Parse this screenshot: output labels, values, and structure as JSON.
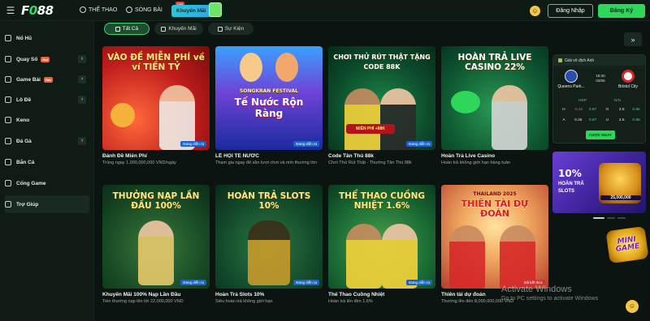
{
  "header": {
    "logo": "F088",
    "nav": [
      {
        "label": "THỂ THAO"
      },
      {
        "label": "SÒNG BÀI",
        "tag": "Live"
      }
    ],
    "promo_label": "Khuyến Mãi",
    "login_label": "Đăng Nhập",
    "register_label": "Đăng Ký"
  },
  "sidebar": {
    "items": [
      {
        "label": "Nổ Hũ",
        "icon": "slot-icon"
      },
      {
        "label": "Quay Số",
        "tag": "Hot",
        "icon": "dice-icon"
      },
      {
        "label": "Game Bài",
        "tag": "Hot",
        "icon": "cards-icon"
      },
      {
        "label": "Lô Đề",
        "icon": "lottery-icon"
      },
      {
        "label": "Keno",
        "icon": "keno-icon"
      },
      {
        "label": "Đá Gà",
        "icon": "rooster-icon"
      },
      {
        "label": "Bắn Cá",
        "icon": "fish-icon"
      },
      {
        "label": "Cổng Game",
        "icon": "gamepad-icon"
      },
      {
        "label": "Trợ Giúp",
        "icon": "help-icon"
      }
    ]
  },
  "tabs": [
    {
      "label": "Tất Cả",
      "active": true
    },
    {
      "label": "Khuyến Mãi",
      "active": false
    },
    {
      "label": "Sự Kiện",
      "active": false
    }
  ],
  "cards": [
    {
      "headline": "VÀO ĐỀ MIỄN PHÍ về ví TIỀN TỶ",
      "title": "Đánh Đề Miễn Phí",
      "desc": "Trúng ngay 1,000,000,000 VND/ngày",
      "status": "Đang diễn ra"
    },
    {
      "headline": "Tế Nước Rộn Ràng",
      "sub": "SONGKRAN FESTIVAL",
      "title": "LỄ HỘI TÉ NƯỚC",
      "desc": "Tham gia ngay để săn lượt chơi và rinh thưởng lớn",
      "status": "Đang diễn ra"
    },
    {
      "headline": "CHƠI THỬ RÚT THẬT TẶNG CODE 88K",
      "badge": "MIỄN PHÍ +88K",
      "title": "Code Tân Thủ 88k",
      "desc": "Chơi Thử Rút Thật - Thưởng Tân Thủ 88k",
      "status": "Đang diễn ra"
    },
    {
      "headline": "HOÀN TRẢ LIVE CASINO 22%",
      "title": "Hoàn Trả Live Casino",
      "desc": "Hoàn trả không giới hạn hàng tuần",
      "status": ""
    },
    {
      "headline": "THƯỞNG NẠP LẦN ĐẦU 100%",
      "title": "Khuyến Mãi 100% Nạp Lần Đầu",
      "desc": "Tiền thưởng nạp lên tới 22,000,000 VND",
      "status": "Đang diễn ra"
    },
    {
      "headline": "HOÀN TRẢ SLOTS 10%",
      "title": "Hoàn Trả Slots 10%",
      "desc": "Siêu hoàn trả không giới hạn",
      "status": "Đang diễn ra"
    },
    {
      "headline": "THỂ THAO CUỒNG NHIỆT 1.6%",
      "title": "Thể Thao Cuồng Nhiệt",
      "desc": "Hoàn trả lên đến 1.6%",
      "status": "Đang diễn ra"
    },
    {
      "headline": "THIÊN TÀI DỰ ĐOÁN",
      "sub": "THAILAND 2025",
      "title": "Thiên tài dự đoán",
      "desc": "Thưởng lên đến 8,000,000,000 VND",
      "status": "Đã kết thúc"
    }
  ],
  "match": {
    "league": "Giải vô địch Anh",
    "home": "Queens Park...",
    "away": "Bristol City",
    "time_line1": "18:30",
    "time_line2": "03/05",
    "header_cells": [
      "",
      "HDP",
      "",
      "O/U",
      ""
    ],
    "rows": [
      {
        "side": "H",
        "handicap": "-0.25",
        "h_odds": "0.87",
        "ou_side": "O",
        "ou_line": "2.5",
        "ou_odds": "0.95"
      },
      {
        "side": "A",
        "handicap": "0.25",
        "h_odds": "0.87",
        "ou_side": "U",
        "ou_line": "2.5",
        "ou_odds": "0.86"
      }
    ],
    "bet_label": "CƯỢC NGAY"
  },
  "slots_ad": {
    "percent": "10%",
    "line1": "HOÀN TRẢ",
    "line2": "SLOTS",
    "amount": "25,000,000"
  },
  "mini_game": {
    "line1": "MINI",
    "line2": "GAME"
  },
  "watermark": {
    "line1": "Activate Windows",
    "line2": "Go to PC settings to activate Windows"
  }
}
